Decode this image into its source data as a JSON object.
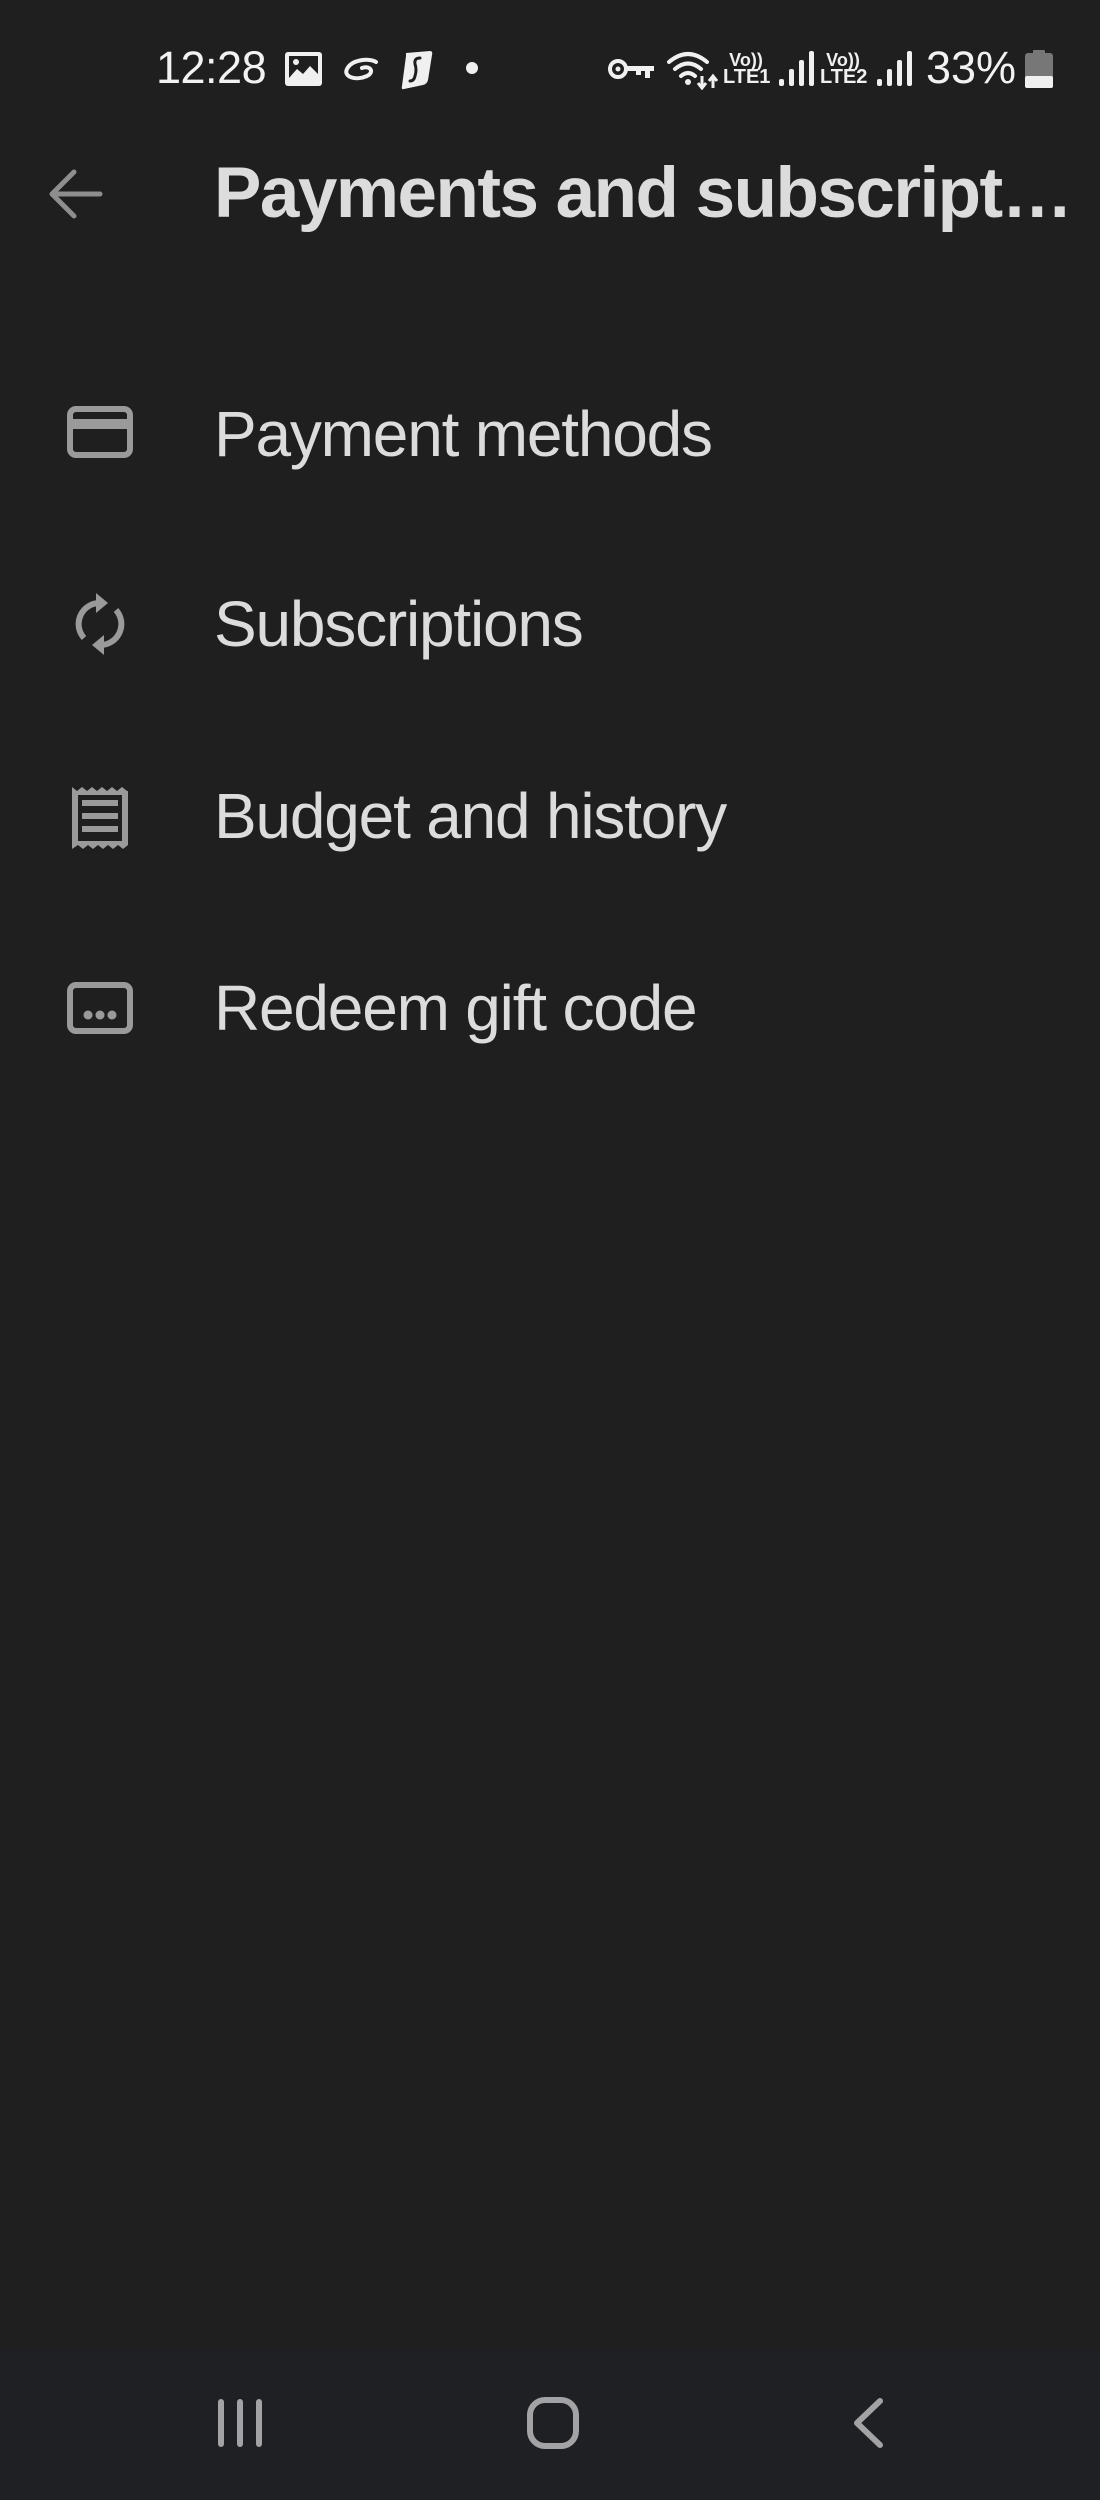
{
  "status_bar": {
    "time": "12:28",
    "notification_icons": [
      "gallery-icon",
      "swirl-app-icon",
      "surfshark-icon",
      "more-notifications-dot"
    ],
    "system_icons": [
      "vpn-key-icon",
      "wifi-data-icon",
      "volte-lte1-signal-icon",
      "volte-lte2-signal-icon"
    ],
    "sim1": {
      "top": "Vo))",
      "bottom": "LTE1"
    },
    "sim2": {
      "top": "Vo))",
      "bottom": "LTE2"
    },
    "battery_percent_text": "33%",
    "battery_level": 0.33
  },
  "app_bar": {
    "back_icon": "arrow-back-icon",
    "title": "Payments and subscript…"
  },
  "menu": {
    "items": [
      {
        "icon": "credit-card-icon",
        "label": "Payment methods"
      },
      {
        "icon": "sync-icon",
        "label": "Subscriptions"
      },
      {
        "icon": "receipt-icon",
        "label": "Budget and history"
      },
      {
        "icon": "gift-code-icon",
        "label": "Redeem gift code"
      }
    ]
  },
  "nav_bar": {
    "buttons": [
      {
        "name": "recents",
        "icon": "recents-icon"
      },
      {
        "name": "home",
        "icon": "home-icon"
      },
      {
        "name": "back",
        "icon": "nav-back-icon"
      }
    ]
  },
  "colors": {
    "background": "#1f1f1f",
    "nav_background": "#1f2023",
    "text_primary": "#dcdcdc",
    "icon_gray": "#9a9a9a"
  }
}
